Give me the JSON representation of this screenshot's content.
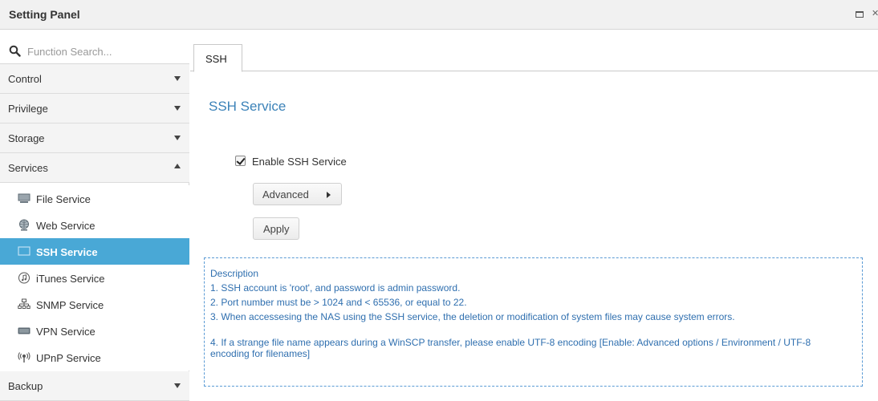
{
  "window": {
    "title": "Setting Panel"
  },
  "search": {
    "placeholder": "Function Search..."
  },
  "sidebar": {
    "categories": [
      {
        "label": "Control"
      },
      {
        "label": "Privilege"
      },
      {
        "label": "Storage"
      },
      {
        "label": "Services"
      },
      {
        "label": "Backup"
      }
    ],
    "services": [
      {
        "label": "File Service",
        "icon": "file-service-icon"
      },
      {
        "label": "Web Service",
        "icon": "globe-icon"
      },
      {
        "label": "SSH Service",
        "icon": "terminal-icon",
        "selected": true
      },
      {
        "label": "iTunes Service",
        "icon": "music-note-icon"
      },
      {
        "label": "SNMP Service",
        "icon": "network-tree-icon"
      },
      {
        "label": "VPN Service",
        "icon": "vpn-icon"
      },
      {
        "label": "UPnP Service",
        "icon": "upnp-icon"
      }
    ]
  },
  "main": {
    "tab_label": "SSH",
    "section_title": "SSH Service",
    "enable_label": "Enable SSH Service",
    "enable_checked": true,
    "advanced_label": "Advanced",
    "apply_label": "Apply",
    "description": {
      "heading": "Description",
      "lines": [
        "1. SSH account is 'root', and password is admin password.",
        "2. Port number must be > 1024 and < 65536, or equal to 22.",
        "3. When accessesing the NAS using the SSH service, the deletion or modification of system files may cause system errors.",
        "4. If a strange file name appears during a WinSCP transfer, please enable UTF-8 encoding [Enable: Advanced options / Environment / UTF-8 encoding for filenames]"
      ]
    }
  },
  "colors": {
    "accent": "#49a8d6",
    "title_blue": "#3b82b8",
    "description_text": "#2f6faf",
    "description_border": "#5b9bd5"
  }
}
